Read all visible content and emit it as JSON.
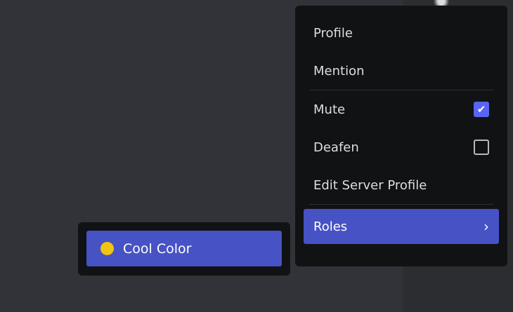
{
  "menu": {
    "items": [
      {
        "label": "Profile"
      },
      {
        "label": "Mention"
      },
      {
        "label": "Mute",
        "checked": true
      },
      {
        "label": "Deafen",
        "checked": false
      },
      {
        "label": "Edit Server Profile"
      },
      {
        "label": "Roles"
      }
    ]
  },
  "roles_submenu": {
    "items": [
      {
        "label": "Cool Color",
        "color": "#f1c40f"
      }
    ]
  }
}
